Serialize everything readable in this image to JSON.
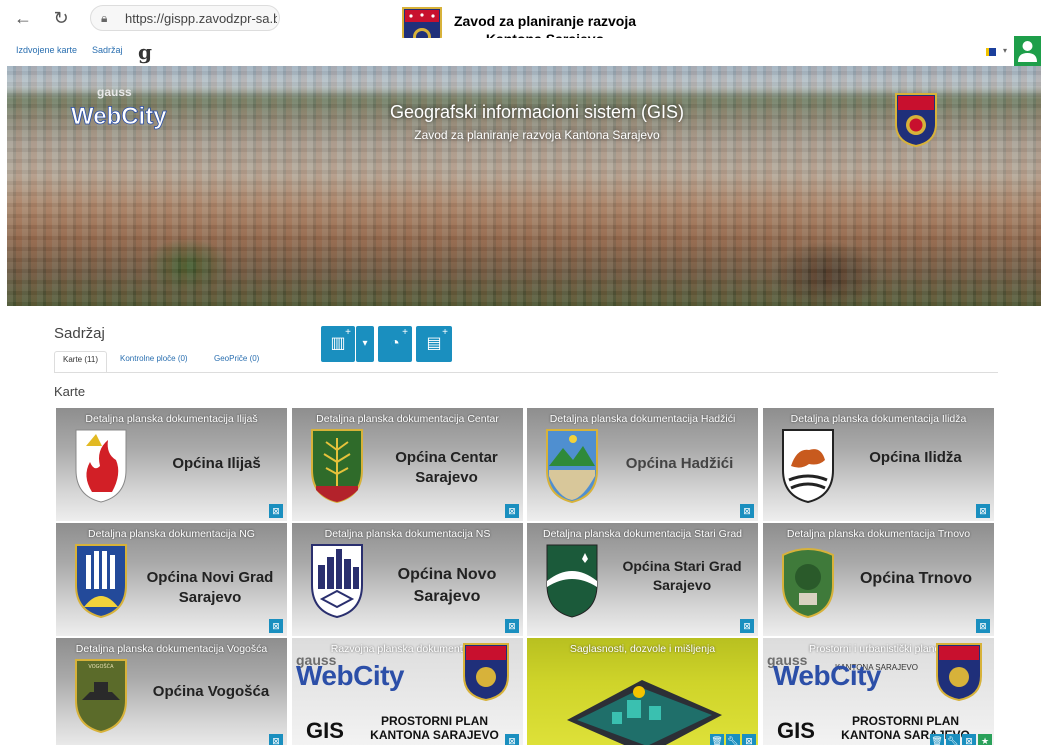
{
  "browser": {
    "url": "https://gispp.zavodzpr-sa.ba/r"
  },
  "institution": {
    "title_line1": "Zavod za planiranje razvoja",
    "title_line2": "Kantona Sarajevo"
  },
  "appnav": {
    "featured": "Izdvojene karte",
    "content": "Sadržaj",
    "gauss_logo": "g"
  },
  "banner": {
    "title": "Geografski informacioni sistem (GIS)",
    "subtitle": "Zavod za planiranje razvoja Kantona Sarajevo",
    "logo_text_top": "gauss",
    "logo_text": "WebCity"
  },
  "content": {
    "title": "Sadržaj",
    "tabs": [
      {
        "label": "Karte (11)"
      },
      {
        "label": "Kontrolne ploče (0)"
      },
      {
        "label": "GeoPriče (0)"
      }
    ],
    "section": "Karte"
  },
  "cards": [
    {
      "caption": "Detaljna planska dokumentacija Ilijaš",
      "name1": "Općina Ilijaš",
      "name2": ""
    },
    {
      "caption": "Detaljna planska dokumentacija Centar",
      "name1": "Općina Centar",
      "name2": "Sarajevo"
    },
    {
      "caption": "Detaljna planska dokumentacija Hadžići",
      "name1": "Općina Hadžići",
      "name2": ""
    },
    {
      "caption": "Detaljna planska dokumentacija Ilidža",
      "name1": "Općina Ilidža",
      "name2": ""
    },
    {
      "caption": "Detaljna planska dokumentacija NG",
      "name1": "Općina Novi Grad",
      "name2": "Sarajevo"
    },
    {
      "caption": "Detaljna planska dokumentacija NS",
      "name1": "Općina Novo",
      "name2": "Sarajevo"
    },
    {
      "caption": "Detaljna planska dokumentacija Stari Grad",
      "name1": "Općina Stari Grad",
      "name2": "Sarajevo"
    },
    {
      "caption": "Detaljna planska dokumentacija Trnovo",
      "name1": "Općina Trnovo",
      "name2": ""
    },
    {
      "caption": "Detaljna planska dokumentacija Vogošća",
      "name1": "Općina Vogošća",
      "name2": "",
      "emblem_text": "VOGOŠĆA"
    },
    {
      "caption": "Razvojna planska dokumentacija",
      "gauss": "gauss",
      "webcity": "WebCity",
      "gis": "GIS",
      "plan1": "PROSTORNI PLAN",
      "plan2": "KANTONA SARAJEVO"
    },
    {
      "caption": "Saglasnosti, dozvole i mišljenja"
    },
    {
      "caption": "Prostorni i urbanistički planovi",
      "gauss": "gauss",
      "webcity": "WebCity",
      "gis": "GIS",
      "plan1": "PROSTORNI PLAN",
      "plan2": "KANTONA SARAJEVO",
      "mini": "KANTONA SARAJEVO"
    }
  ],
  "colors": {
    "accent": "#1a8fbf",
    "user_button": "#1e9e4a",
    "link": "#2a6fb0"
  }
}
